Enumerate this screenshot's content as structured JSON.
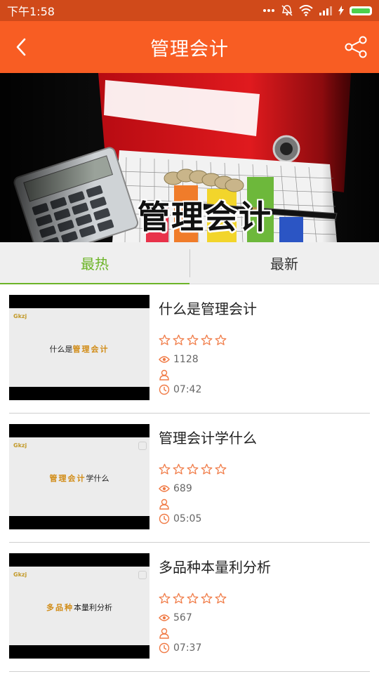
{
  "status_bar": {
    "time": "下午1:58"
  },
  "header": {
    "title": "管理会计"
  },
  "banner": {
    "title": "管理会计"
  },
  "tabs": [
    {
      "label": "最热",
      "active": true
    },
    {
      "label": "最新",
      "active": false
    }
  ],
  "courses": [
    {
      "title": "什么是管理会计",
      "views": "1128",
      "author": "",
      "duration": "07:42",
      "thumb_prefix": "什么是",
      "thumb_highlight": "管理会计",
      "thumb_suffix": ""
    },
    {
      "title": "管理会计学什么",
      "views": "689",
      "author": "",
      "duration": "05:05",
      "thumb_prefix": "",
      "thumb_highlight": "管理会计",
      "thumb_suffix": "学什么"
    },
    {
      "title": "多品种本量利分析",
      "views": "567",
      "author": "",
      "duration": "07:37",
      "thumb_prefix": "",
      "thumb_highlight": "多品种",
      "thumb_suffix": "本量利分析"
    }
  ],
  "colors": {
    "status_bar": "#d04a1a",
    "header": "#f85d23",
    "tab_active": "#6cb427",
    "star_outline": "#f07a45"
  },
  "icons": {
    "back": "chevron-left-icon",
    "share": "share-icon",
    "expand": "chevron-down-icon",
    "views": "eye-icon",
    "author": "user-icon",
    "duration": "clock-icon"
  }
}
